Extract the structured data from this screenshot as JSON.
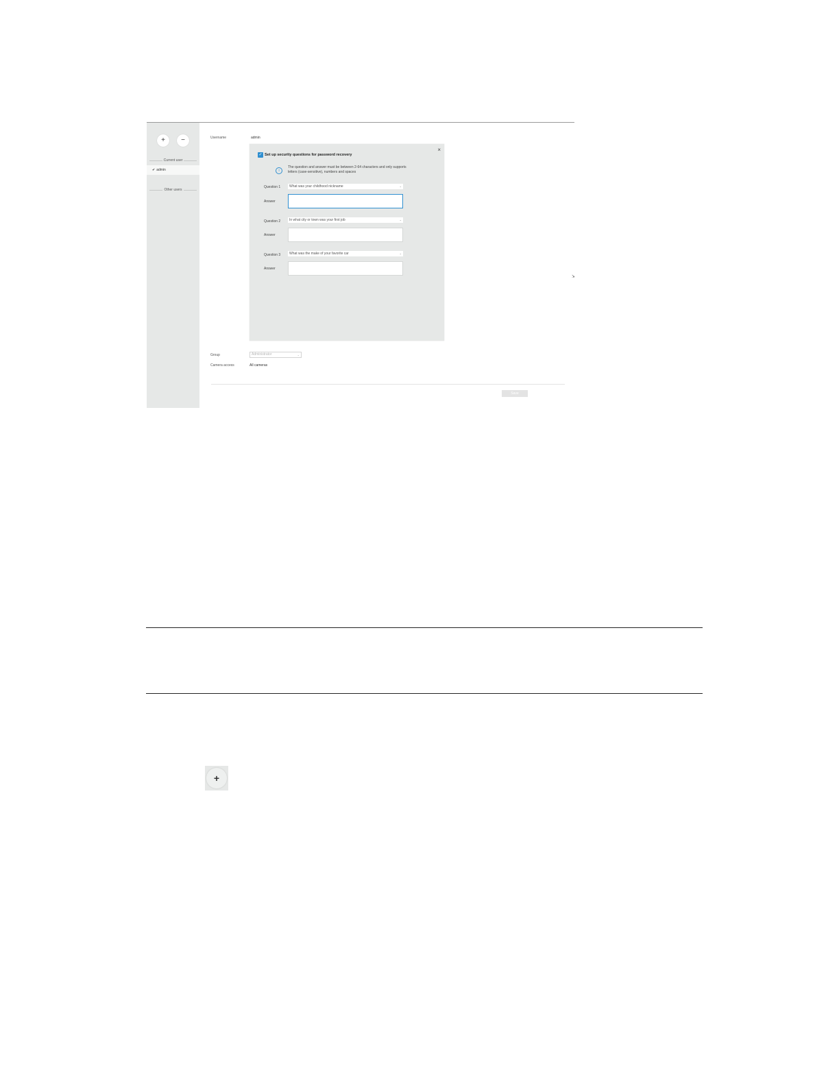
{
  "sidebar": {
    "add_symbol": "+",
    "remove_symbol": "−",
    "current_user_label": "Current user",
    "current_user": "admin",
    "check_symbol": "✔",
    "other_users_label": "Other users"
  },
  "main": {
    "username_label": "Username",
    "username_value": "admin",
    "group_label": "Group",
    "group_value": "Administrator",
    "camera_access_label": "Camera access",
    "camera_access_value": "All cameras",
    "save_label": "Save"
  },
  "dialog": {
    "close_symbol": "×",
    "checkbox_symbol": "✓",
    "checkbox_label": "Set up security questions for password recovery",
    "info_symbol": "i",
    "info_text": "The question and answer must be between 2-64 characters and only supports letters (case-sensitive), numbers and spaces",
    "questions": [
      {
        "label": "Question 1",
        "value": "What was your childhood nickname",
        "answer_label": "Answer",
        "answer_value": ""
      },
      {
        "label": "Question 2",
        "value": "In what city or town was your first job",
        "answer_label": "Answer",
        "answer_value": ""
      },
      {
        "label": "Question 3",
        "value": "What was the make of your favorite car",
        "answer_label": "Answer",
        "answer_value": ""
      }
    ]
  },
  "add_button_crop": {
    "symbol": "+"
  }
}
